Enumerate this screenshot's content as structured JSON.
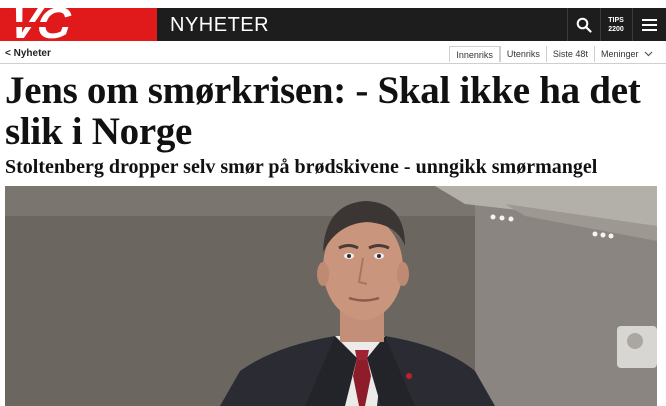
{
  "header": {
    "logo_text": "VG",
    "section": "NYHETER",
    "tips_line1": "TIPS",
    "tips_line2": "2200",
    "icons": [
      "search-icon",
      "menu-icon"
    ],
    "colors": {
      "brand_red": "#e0191b",
      "bar_dark": "#1d1d1d"
    }
  },
  "subnav": {
    "back": "< Nyheter",
    "tabs": [
      {
        "label": "Innenriks",
        "active": true
      },
      {
        "label": "Utenriks",
        "active": false
      },
      {
        "label": "Siste 48t",
        "active": false
      },
      {
        "label": "Meninger",
        "active": false,
        "dropdown": true
      }
    ]
  },
  "article": {
    "headline": "Jens om smørkrisen: - Skal ikke ha det slik i Norge",
    "subheadline": "Stoltenberg dropper selv smør på brødskivene - unngikk smørmangel"
  }
}
